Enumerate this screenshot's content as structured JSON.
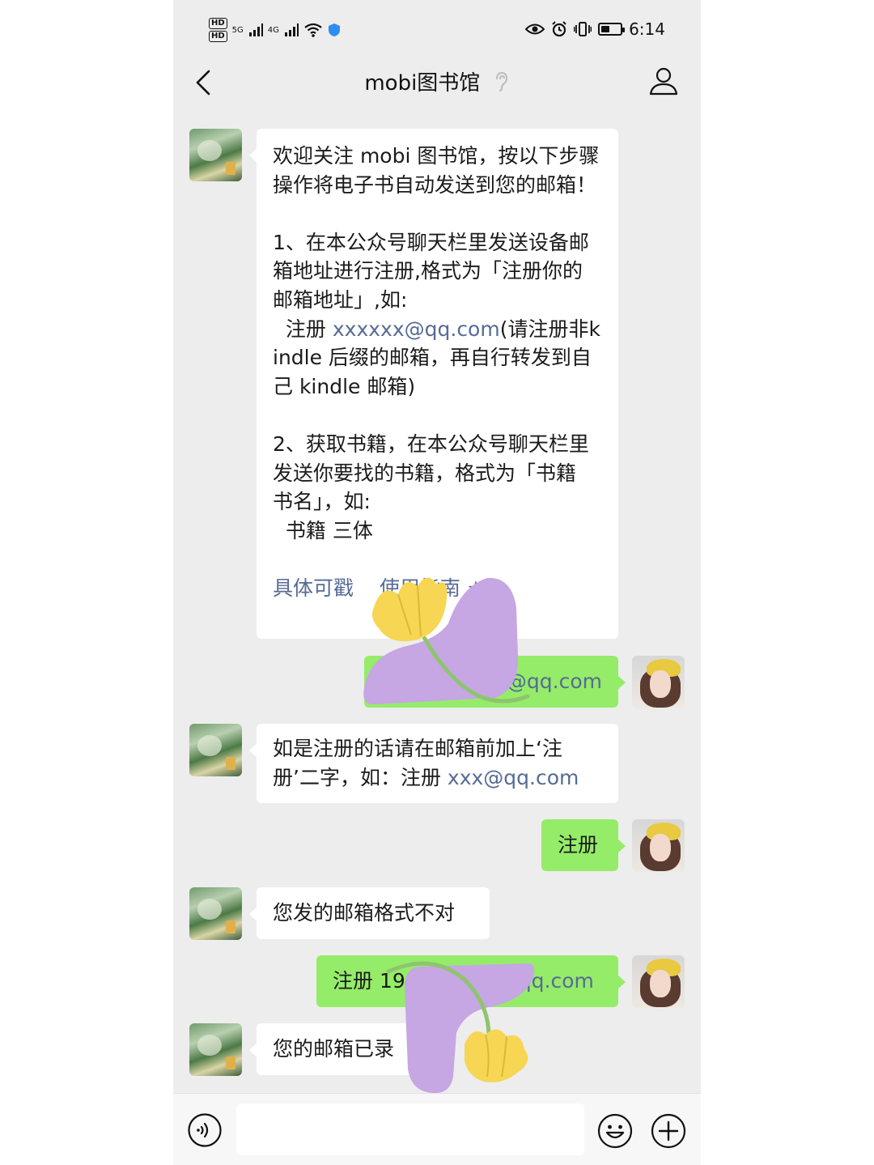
{
  "status_bar": {
    "hd_badges": [
      "HD",
      "HD"
    ],
    "signal_labels": [
      "5G",
      "4G"
    ],
    "time": "6:14",
    "battery_level": 0.45,
    "icons": [
      "hd-icon",
      "signal-icon",
      "wifi-icon",
      "shield-icon",
      "eye-icon",
      "alarm-icon",
      "vibrate-icon",
      "battery-icon"
    ]
  },
  "header": {
    "title": "mobi图书馆",
    "icons": [
      "back-icon",
      "ear-icon",
      "person-icon"
    ]
  },
  "messages": [
    {
      "side": "in",
      "parts": [
        "欢迎关注 mobi 图书馆，按以下步骤操作将电子书自动发送到您的邮箱！",
        "1、在本公众号聊天栏里发送设备邮箱地址进行注册,格式为「注册你的邮箱地址」,如:",
        "  注册 ",
        "xxxxxx@qq.com",
        "(请注册非kindle 后缀的邮箱，再自行转发到自己 kindle 邮箱)",
        "2、获取书籍，在本公众号聊天栏里发送你要找的书籍，格式为「书籍 书名」，如:",
        "  书籍 三体",
        "具体可戳",
        "使用指南 ★"
      ]
    },
    {
      "side": "out",
      "text": "5@qq.com"
    },
    {
      "side": "in",
      "text_a": "如是注册的话请在邮箱前加上‘注册’二字，如：注册 ",
      "link": "xxx@qq.com"
    },
    {
      "side": "out",
      "text": "注册"
    },
    {
      "side": "in",
      "text": "您发的邮箱格式不对"
    },
    {
      "side": "out",
      "text_a": "注册 19",
      "text_b": "qq.com"
    },
    {
      "side": "in",
      "text": "您的邮箱已录"
    }
  ],
  "input_bar": {
    "icons": [
      "voice-icon",
      "emoji-icon",
      "plus-icon"
    ]
  },
  "colors": {
    "chat_bg": "#ededed",
    "bubble_out": "#95ec69",
    "bubble_in": "#ffffff",
    "link": "#576b95",
    "sticker_purple": "#c6a6e3",
    "sticker_yellow": "#f6d653",
    "sticker_stem": "#8fc46f"
  }
}
